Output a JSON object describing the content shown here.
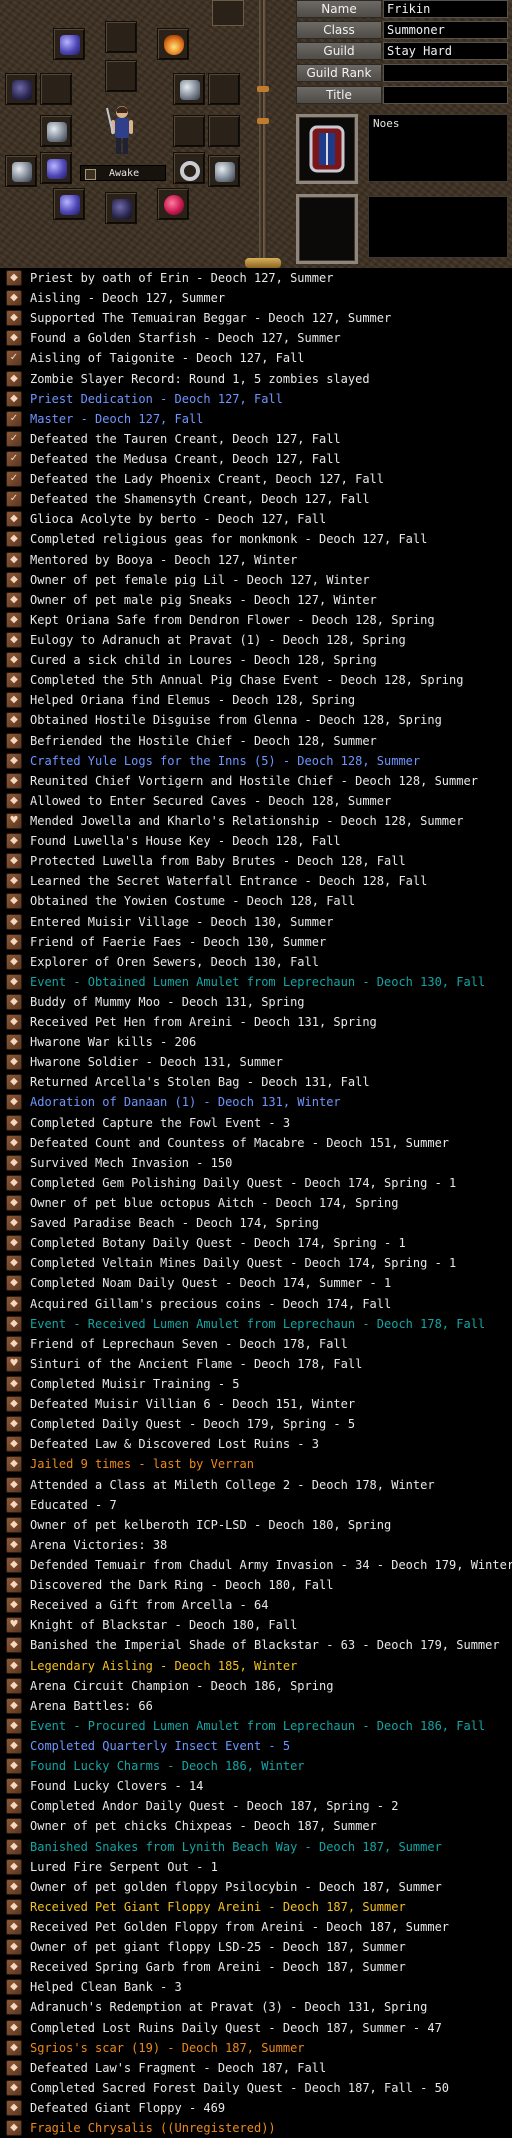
{
  "profile": {
    "labels": {
      "name": "Name",
      "class": "Class",
      "guild": "Guild",
      "guild_rank": "Guild Rank",
      "title": "Title"
    },
    "values": {
      "name": "Frikin",
      "class": "Summoner",
      "guild": "Stay Hard",
      "guild_rank": "",
      "title": ""
    },
    "status_label": "Awake",
    "profile_text": "Noes",
    "portrait_icon": "shield-portrait-icon"
  },
  "colors": {
    "default": "#e9e9e9",
    "blue": "#6f96ff",
    "teal": "#14a5a5",
    "orange": "#ee8a1c",
    "yellow": "#f4c21e",
    "background": "#000000"
  },
  "legends": [
    {
      "text": "Priest by oath of Erin - Deoch 127, Summer",
      "color": "default",
      "icon": "crest"
    },
    {
      "text": "Aisling - Deoch 127, Summer",
      "color": "default",
      "icon": "crest"
    },
    {
      "text": "Supported The Temuairan Beggar - Deoch 127, Summer",
      "color": "default",
      "icon": "crest"
    },
    {
      "text": "Found a Golden Starfish - Deoch 127, Summer",
      "color": "default",
      "icon": "crest"
    },
    {
      "text": "Aisling of Taigonite - Deoch 127, Fall",
      "color": "default",
      "icon": "check"
    },
    {
      "text": "Zombie Slayer Record: Round 1, 5 zombies slayed",
      "color": "default",
      "icon": "crest"
    },
    {
      "text": "Priest Dedication - Deoch 127, Fall",
      "color": "blue",
      "icon": "crest"
    },
    {
      "text": "Master - Deoch 127, Fall",
      "color": "blue",
      "icon": "check"
    },
    {
      "text": "Defeated the Tauren Creant, Deoch 127, Fall",
      "color": "default",
      "icon": "check"
    },
    {
      "text": "Defeated the Medusa Creant, Deoch 127, Fall",
      "color": "default",
      "icon": "check"
    },
    {
      "text": "Defeated the Lady Phoenix Creant, Deoch 127, Fall",
      "color": "default",
      "icon": "check"
    },
    {
      "text": "Defeated the Shamensyth Creant, Deoch 127, Fall",
      "color": "default",
      "icon": "check"
    },
    {
      "text": "Glioca Acolyte by berto - Deoch 127, Fall",
      "color": "default",
      "icon": "crest"
    },
    {
      "text": "Completed religious geas for monkmonk - Deoch 127, Fall",
      "color": "default",
      "icon": "crest"
    },
    {
      "text": "Mentored by Booya - Deoch 127, Winter",
      "color": "default",
      "icon": "crest"
    },
    {
      "text": "Owner of pet female pig Lil - Deoch 127, Winter",
      "color": "default",
      "icon": "crest"
    },
    {
      "text": "Owner of pet male pig Sneaks - Deoch 127, Winter",
      "color": "default",
      "icon": "crest"
    },
    {
      "text": "Kept Oriana Safe from Dendron Flower - Deoch 128, Spring",
      "color": "default",
      "icon": "crest"
    },
    {
      "text": "Eulogy to Adranuch at Pravat (1) - Deoch 128, Spring",
      "color": "default",
      "icon": "crest"
    },
    {
      "text": "Cured a sick child in Loures - Deoch 128, Spring",
      "color": "default",
      "icon": "crest"
    },
    {
      "text": "Completed the 5th Annual Pig Chase Event - Deoch 128, Spring",
      "color": "default",
      "icon": "crest"
    },
    {
      "text": "Helped Oriana find Elemus - Deoch 128, Spring",
      "color": "default",
      "icon": "crest"
    },
    {
      "text": "Obtained Hostile Disguise from Glenna - Deoch 128, Spring",
      "color": "default",
      "icon": "crest"
    },
    {
      "text": "Befriended the Hostile Chief - Deoch 128, Summer",
      "color": "default",
      "icon": "crest"
    },
    {
      "text": "Crafted Yule Logs for the Inns (5) - Deoch 128, Summer",
      "color": "blue",
      "icon": "crest"
    },
    {
      "text": "Reunited Chief Vortigern and Hostile Chief - Deoch 128, Summer",
      "color": "default",
      "icon": "crest"
    },
    {
      "text": "Allowed to Enter Secured Caves - Deoch 128, Summer",
      "color": "default",
      "icon": "crest"
    },
    {
      "text": "Mended Jowella and Kharlo's Relationship - Deoch 128, Summer",
      "color": "default",
      "icon": "heart"
    },
    {
      "text": "Found Luwella's House Key - Deoch 128, Fall",
      "color": "default",
      "icon": "crest"
    },
    {
      "text": "Protected Luwella from Baby Brutes - Deoch 128, Fall",
      "color": "default",
      "icon": "crest"
    },
    {
      "text": "Learned the Secret Waterfall Entrance - Deoch 128, Fall",
      "color": "default",
      "icon": "crest"
    },
    {
      "text": "Obtained the Yowien Costume - Deoch 128, Fall",
      "color": "default",
      "icon": "crest"
    },
    {
      "text": "Entered Muisir Village - Deoch 130, Summer",
      "color": "default",
      "icon": "crest"
    },
    {
      "text": "Friend of Faerie Faes - Deoch 130, Summer",
      "color": "default",
      "icon": "crest"
    },
    {
      "text": "Explorer of Oren Sewers, Deoch 130, Fall",
      "color": "default",
      "icon": "crest"
    },
    {
      "text": "Event - Obtained Lumen Amulet from Leprechaun - Deoch 130, Fall",
      "color": "teal",
      "icon": "crest"
    },
    {
      "text": "Buddy of Mummy Moo - Deoch 131, Spring",
      "color": "default",
      "icon": "crest"
    },
    {
      "text": "Received Pet Hen from Areini - Deoch 131, Spring",
      "color": "default",
      "icon": "crest"
    },
    {
      "text": "Hwarone War kills - 206",
      "color": "default",
      "icon": "crest"
    },
    {
      "text": "Hwarone Soldier - Deoch 131, Summer",
      "color": "default",
      "icon": "crest"
    },
    {
      "text": "Returned Arcella's Stolen Bag - Deoch 131, Fall",
      "color": "default",
      "icon": "crest"
    },
    {
      "text": "Adoration of Danaan (1) - Deoch 131, Winter",
      "color": "blue",
      "icon": "crest"
    },
    {
      "text": "Completed Capture the Fowl Event - 3",
      "color": "default",
      "icon": "crest"
    },
    {
      "text": "Defeated Count and Countess of Macabre - Deoch 151, Summer",
      "color": "default",
      "icon": "crest"
    },
    {
      "text": "Survived Mech Invasion - 150",
      "color": "default",
      "icon": "crest"
    },
    {
      "text": "Completed Gem Polishing Daily Quest - Deoch 174, Spring - 1",
      "color": "default",
      "icon": "crest"
    },
    {
      "text": "Owner of pet blue octopus Aitch - Deoch 174, Spring",
      "color": "default",
      "icon": "crest"
    },
    {
      "text": "Saved Paradise Beach - Deoch 174, Spring",
      "color": "default",
      "icon": "crest"
    },
    {
      "text": "Completed Botany Daily Quest - Deoch 174, Spring - 1",
      "color": "default",
      "icon": "crest"
    },
    {
      "text": "Completed Veltain Mines Daily Quest - Deoch 174, Spring - 1",
      "color": "default",
      "icon": "crest"
    },
    {
      "text": "Completed Noam Daily Quest - Deoch 174, Summer - 1",
      "color": "default",
      "icon": "crest"
    },
    {
      "text": "Acquired Gillam's precious coins - Deoch 174, Fall",
      "color": "default",
      "icon": "crest"
    },
    {
      "text": "Event - Received Lumen Amulet from Leprechaun - Deoch 178, Fall",
      "color": "teal",
      "icon": "crest"
    },
    {
      "text": "Friend of Leprechaun Seven - Deoch 178, Fall",
      "color": "default",
      "icon": "crest"
    },
    {
      "text": "Sinturi of the Ancient Flame - Deoch 178, Fall",
      "color": "default",
      "icon": "heart"
    },
    {
      "text": "Completed Muisir Training - 5",
      "color": "default",
      "icon": "crest"
    },
    {
      "text": "Defeated Muisir Villian 6 - Deoch 151, Winter",
      "color": "default",
      "icon": "crest"
    },
    {
      "text": "Completed Daily Quest - Deoch 179, Spring - 5",
      "color": "default",
      "icon": "crest"
    },
    {
      "text": "Defeated Law & Discovered Lost Ruins - 3",
      "color": "default",
      "icon": "crest"
    },
    {
      "text": "Jailed 9 times - last by Verran",
      "color": "orange",
      "icon": "crest"
    },
    {
      "text": "Attended a Class at Mileth College 2 - Deoch 178, Winter",
      "color": "default",
      "icon": "crest"
    },
    {
      "text": "Educated - 7",
      "color": "default",
      "icon": "crest"
    },
    {
      "text": "Owner of pet kelberoth ICP-LSD - Deoch 180, Spring",
      "color": "default",
      "icon": "crest"
    },
    {
      "text": "Arena Victories: 38",
      "color": "default",
      "icon": "crest"
    },
    {
      "text": "Defended Temuair from Chadul Army Invasion - 34 - Deoch 179, Winter",
      "color": "default",
      "icon": "crest"
    },
    {
      "text": "Discovered the Dark Ring - Deoch 180, Fall",
      "color": "default",
      "icon": "crest"
    },
    {
      "text": "Received a Gift from Arcella - 64",
      "color": "default",
      "icon": "crest"
    },
    {
      "text": "Knight of Blackstar - Deoch 180, Fall",
      "color": "default",
      "icon": "heart"
    },
    {
      "text": "Banished the Imperial Shade of Blackstar - 63 - Deoch 179, Summer",
      "color": "default",
      "icon": "crest"
    },
    {
      "text": "Legendary Aisling - Deoch 185, Winter",
      "color": "yellow",
      "icon": "crest"
    },
    {
      "text": "Arena Circuit Champion - Deoch 186, Spring",
      "color": "default",
      "icon": "crest"
    },
    {
      "text": "Arena Battles: 66",
      "color": "default",
      "icon": "crest"
    },
    {
      "text": "Event - Procured Lumen Amulet from Leprechaun - Deoch 186, Fall",
      "color": "teal",
      "icon": "crest"
    },
    {
      "text": "Completed Quarterly Insect Event - 5",
      "color": "blue",
      "icon": "crest"
    },
    {
      "text": "Found Lucky Charms - Deoch 186, Winter",
      "color": "teal",
      "icon": "crest"
    },
    {
      "text": "Found Lucky Clovers - 14",
      "color": "default",
      "icon": "crest"
    },
    {
      "text": "Completed Andor Daily Quest - Deoch 187, Spring - 2",
      "color": "default",
      "icon": "crest"
    },
    {
      "text": "Owner of pet chicks Chixpeas - Deoch 187, Summer",
      "color": "default",
      "icon": "crest"
    },
    {
      "text": "Banished Snakes from Lynith Beach Way - Deoch 187, Summer",
      "color": "teal",
      "icon": "crest"
    },
    {
      "text": "Lured Fire Serpent Out - 1",
      "color": "default",
      "icon": "crest"
    },
    {
      "text": "Owner of pet golden floppy Psilocybin - Deoch 187, Summer",
      "color": "default",
      "icon": "crest"
    },
    {
      "text": "Received Pet Giant Floppy Areini - Deoch 187, Summer",
      "color": "yellow",
      "icon": "crest"
    },
    {
      "text": "Received Pet Golden Floppy from Areini - Deoch 187, Summer",
      "color": "default",
      "icon": "crest"
    },
    {
      "text": "Owner of pet giant floppy LSD-25 - Deoch 187, Summer",
      "color": "default",
      "icon": "crest"
    },
    {
      "text": "Received Spring Garb from Areini - Deoch 187, Summer",
      "color": "default",
      "icon": "crest"
    },
    {
      "text": "Helped Clean Bank - 3",
      "color": "default",
      "icon": "crest"
    },
    {
      "text": "Adranuch's Redemption at Pravat (3) - Deoch 131, Spring",
      "color": "default",
      "icon": "crest"
    },
    {
      "text": "Completed Lost Ruins Daily Quest - Deoch 187, Summer - 47",
      "color": "default",
      "icon": "crest"
    },
    {
      "text": "Sgrios's scar (19) - Deoch 187, Summer",
      "color": "orange",
      "icon": "crest"
    },
    {
      "text": "Defeated Law's Fragment - Deoch 187, Fall",
      "color": "default",
      "icon": "crest"
    },
    {
      "text": "Completed Sacred Forest Daily Quest - Deoch 187, Fall - 50",
      "color": "default",
      "icon": "crest"
    },
    {
      "text": "Defeated Giant Floppy - 469",
      "color": "default",
      "icon": "crest"
    },
    {
      "text": "Fragile Chrysalis ((Unregistered))",
      "color": "orange",
      "icon": "crest"
    }
  ]
}
